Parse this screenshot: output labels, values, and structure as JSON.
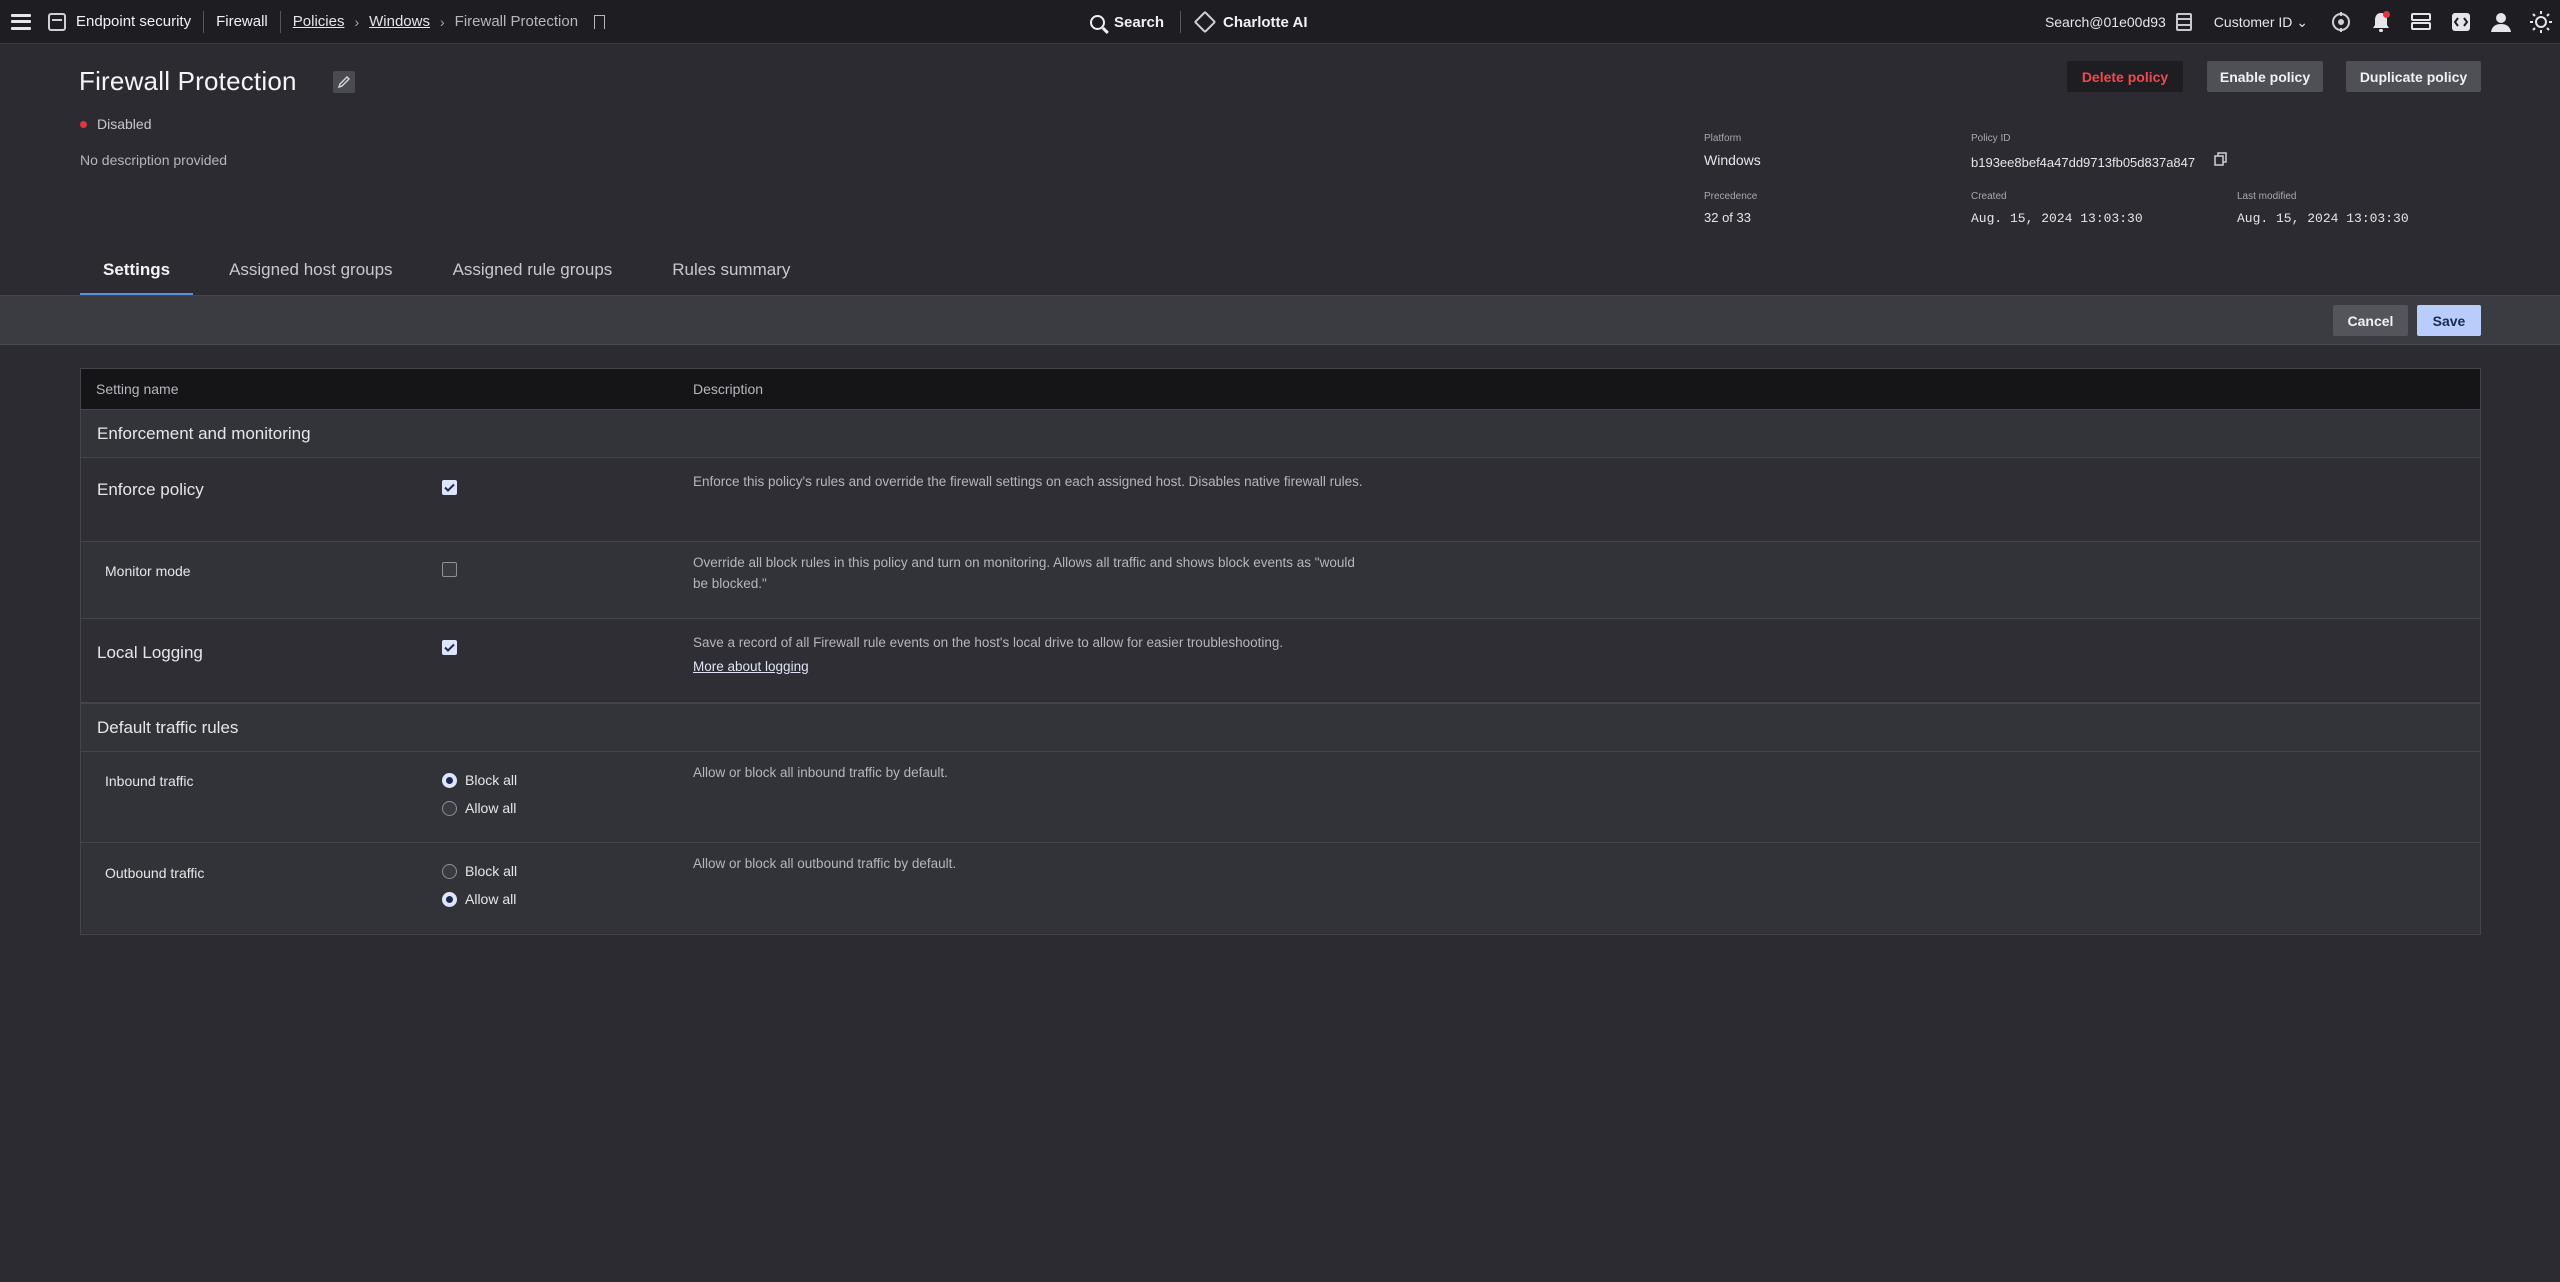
{
  "topbar": {
    "product": "Endpoint security",
    "module": "Firewall",
    "breadcrumb": [
      "Policies",
      "Windows",
      "Firewall Protection"
    ],
    "search_label": "Search",
    "ai_label": "Charlotte AI",
    "user": "Search@01e00d93",
    "customer_label": "Customer ID"
  },
  "header": {
    "title": "Firewall Protection",
    "status": "Disabled",
    "description": "No description provided",
    "buttons": {
      "delete": "Delete policy",
      "enable": "Enable policy",
      "duplicate": "Duplicate policy"
    },
    "meta": {
      "platform_label": "Platform",
      "platform": "Windows",
      "policy_id_label": "Policy ID",
      "policy_id": "b193ee8bef4a47dd9713fb05d837a847",
      "precedence_label": "Precedence",
      "precedence": "32 of 33",
      "created_label": "Created",
      "created": "Aug. 15, 2024 13:03:30",
      "modified_label": "Last modified",
      "modified": "Aug. 15, 2024 13:03:30"
    }
  },
  "tabs": [
    "Settings",
    "Assigned host groups",
    "Assigned rule groups",
    "Rules summary"
  ],
  "actions": {
    "cancel": "Cancel",
    "save": "Save"
  },
  "table": {
    "col_name": "Setting name",
    "col_desc": "Description",
    "section1": "Enforcement and monitoring",
    "enforce": {
      "name": "Enforce policy",
      "checked": true,
      "desc": "Enforce this policy's rules and override the firewall settings on each assigned host. Disables native firewall rules."
    },
    "monitor": {
      "name": "Monitor mode",
      "checked": false,
      "desc": "Override all block rules in this policy and turn on monitoring. Allows all traffic and shows block events as \"would be blocked.\""
    },
    "logging": {
      "name": "Local Logging",
      "checked": true,
      "desc": "Save a record of all Firewall rule events on the host's local drive to allow for easier troubleshooting.",
      "link": "More about logging"
    },
    "section2": "Default traffic rules",
    "inbound": {
      "name": "Inbound traffic",
      "options": [
        "Block all",
        "Allow all"
      ],
      "selected": "Block all",
      "desc": "Allow or block all inbound traffic by default."
    },
    "outbound": {
      "name": "Outbound traffic",
      "options": [
        "Block all",
        "Allow all"
      ],
      "selected": "Allow all",
      "desc": "Allow or block all outbound traffic by default."
    }
  },
  "colors": {
    "accent": "#5a8ee6",
    "danger": "#e2353f",
    "save_bg": "#b8cdfb"
  }
}
